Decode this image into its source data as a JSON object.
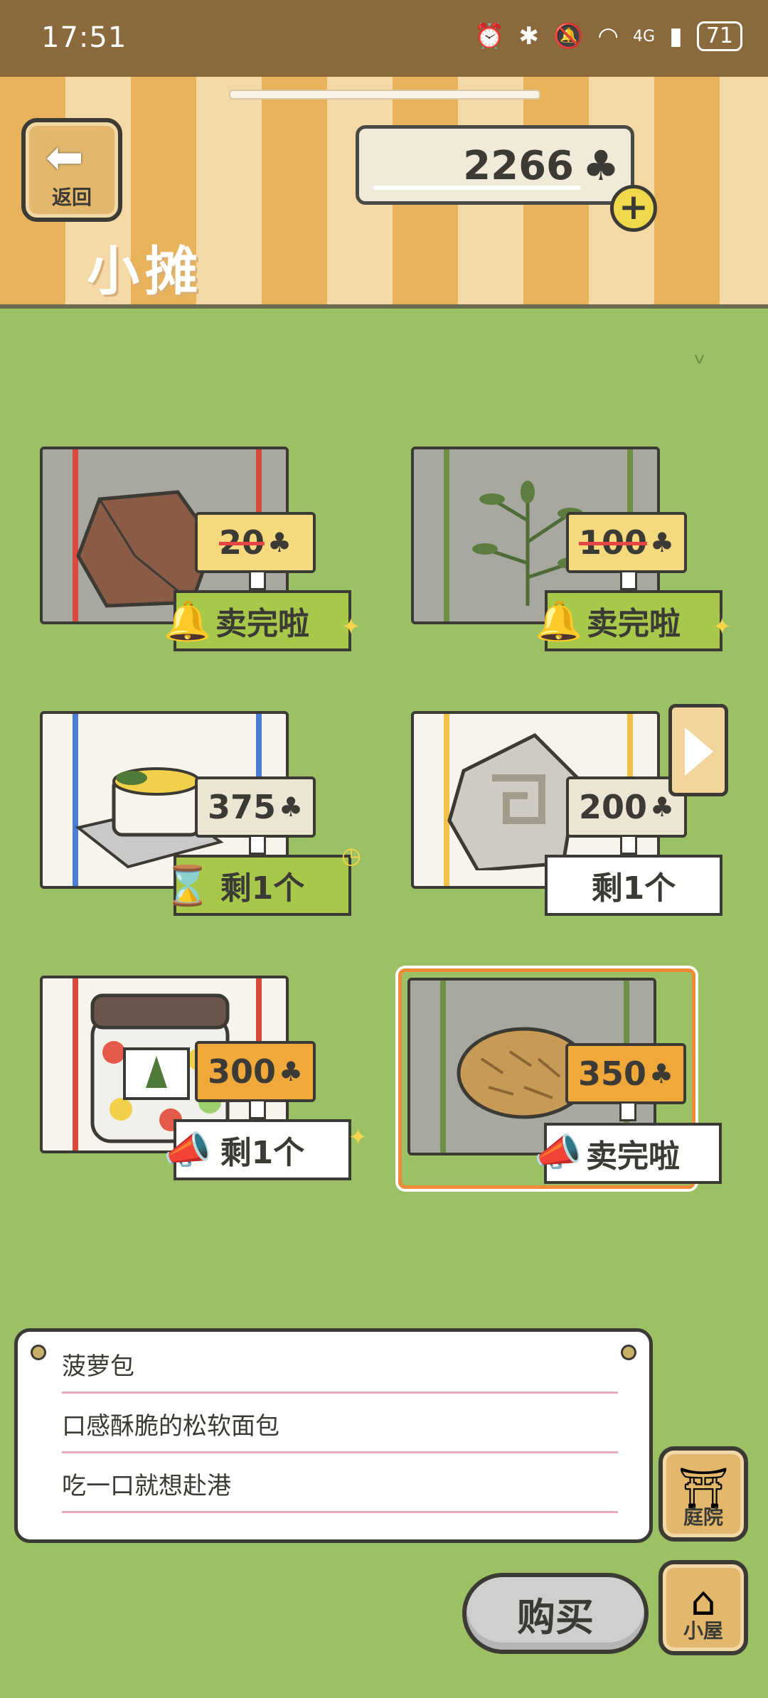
{
  "status_bar": {
    "time": "17:51",
    "network": "4G",
    "battery": "71"
  },
  "header": {
    "back_label": "返回",
    "title": "小摊",
    "coins": "2266",
    "currency_icon": "clover-icon"
  },
  "items": [
    {
      "name": "rock-block",
      "price": "20",
      "price_struck": true,
      "status": "卖完啦",
      "status_icon": "bell-icon",
      "stripe_color": "#d9493c",
      "cloth_color": "#a9a8a0"
    },
    {
      "name": "herb-sprig",
      "price": "100",
      "price_struck": true,
      "status": "卖完啦",
      "status_icon": "bell-icon",
      "stripe_color": "#6f8f44",
      "cloth_color": "#a9a8a0"
    },
    {
      "name": "gratin-dish",
      "price": "375",
      "price_struck": false,
      "status": "剩1个",
      "status_icon": "hourglass-icon",
      "stripe_color": "#4c7ed6",
      "cloth_color": "#f7f4ec"
    },
    {
      "name": "stone-charm",
      "price": "200",
      "price_struck": false,
      "status": "剩1个",
      "status_icon": "",
      "stripe_color": "#f2c149",
      "cloth_color": "#f7f4ec"
    },
    {
      "name": "candy-jar",
      "price": "300",
      "price_struck": false,
      "status": "剩1个",
      "status_icon": "megaphone-icon",
      "stripe_color": "#d9493c",
      "cloth_color": "#f7f4ec"
    },
    {
      "name": "pineapple-bun",
      "price": "350",
      "price_struck": false,
      "status": "卖完啦",
      "status_icon": "megaphone-icon",
      "stripe_color": "#6f8f44",
      "cloth_color": "#a9a8a0"
    }
  ],
  "description": {
    "line1": "菠萝包",
    "line2": "口感酥脆的松软面包",
    "line3": "吃一口就想赴港"
  },
  "side_buttons": {
    "yard_label": "庭院",
    "house_label": "小屋"
  },
  "buy_label": "购买"
}
